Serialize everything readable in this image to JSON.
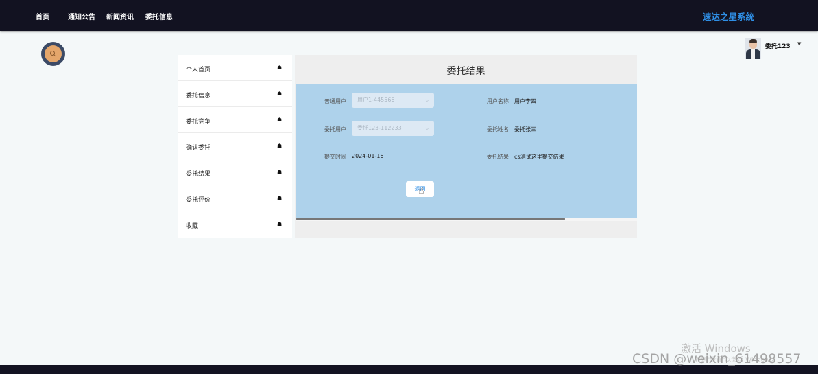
{
  "nav": {
    "items": [
      {
        "label": "首页"
      },
      {
        "label": "通知公告"
      },
      {
        "label": "新闻资讯"
      },
      {
        "label": "委托信息"
      }
    ],
    "brand": "速达之星系统"
  },
  "user": {
    "name": "委托123",
    "avatar_icon": "avatar-photo-icon",
    "dropdown_icon": "caret-down-icon"
  },
  "search_button": {
    "icon": "search-icon",
    "color": "#e4a66b"
  },
  "sidebar": {
    "items": [
      {
        "label": "个人首页",
        "icon": "home-icon"
      },
      {
        "label": "委托信息",
        "icon": "home-icon"
      },
      {
        "label": "委托竞争",
        "icon": "home-icon"
      },
      {
        "label": "确认委托",
        "icon": "home-icon"
      },
      {
        "label": "委托结果",
        "icon": "home-icon"
      },
      {
        "label": "委托评价",
        "icon": "home-icon"
      },
      {
        "label": "收藏",
        "icon": "home-icon"
      }
    ]
  },
  "panel": {
    "title": "委托结果",
    "fields": {
      "normal_user": {
        "label": "普通用户",
        "value": "用户1-445566"
      },
      "user_name": {
        "label": "用户名称",
        "value": "用户李四"
      },
      "client_user": {
        "label": "委托用户",
        "value": "委托123-112233"
      },
      "client_name": {
        "label": "委托姓名",
        "value": "委托张三"
      },
      "submit_time": {
        "label": "提交时间",
        "value": "2024-01-16"
      },
      "result": {
        "label": "委托结果",
        "value": "cs测试这里提交结果"
      }
    },
    "back_button": "返回"
  },
  "watermarks": {
    "windows_line1": "激活 Windows",
    "windows_line2": "转到\"设置\"以激活 Windows。",
    "csdn": "CSDN @weixin_61498557"
  },
  "colors": {
    "topbar": "#121221",
    "brand": "#2f8fe6",
    "form_bg": "#aed2eb",
    "page_bg": "#f4f8f9"
  }
}
